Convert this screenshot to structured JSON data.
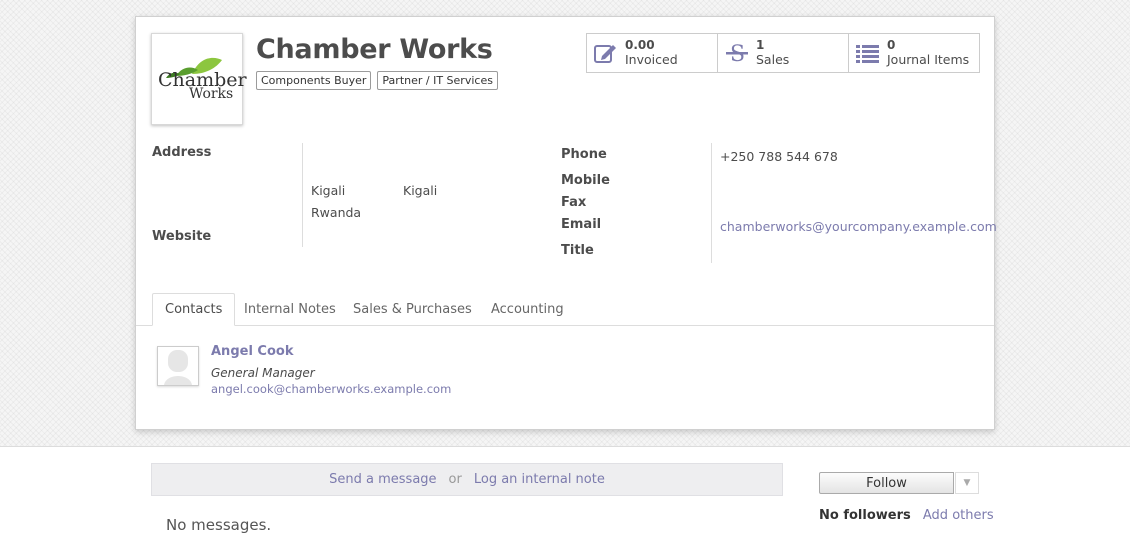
{
  "partner": {
    "name": "Chamber Works",
    "logo_text_line1": "Chamber",
    "logo_text_line2": "Works",
    "tags": [
      "Components Buyer",
      "Partner / IT Services"
    ]
  },
  "smart_buttons": [
    {
      "value": "0.00",
      "label": "Invoiced",
      "icon": "pencil-square-icon"
    },
    {
      "value": "1",
      "label": "Sales",
      "icon": "strikethrough-s-icon"
    },
    {
      "value": "0",
      "label": "Journal Items",
      "icon": "list-icon"
    }
  ],
  "fields": {
    "address_label": "Address",
    "website_label": "Website",
    "city": "Kigali",
    "state": "Kigali",
    "country": "Rwanda",
    "phone_label": "Phone",
    "mobile_label": "Mobile",
    "fax_label": "Fax",
    "email_label": "Email",
    "title_label": "Title",
    "phone": "+250 788 544 678",
    "email": "chamberworks@yourcompany.example.com"
  },
  "tabs": [
    {
      "label": "Contacts",
      "active": true
    },
    {
      "label": "Internal Notes",
      "active": false
    },
    {
      "label": "Sales & Purchases",
      "active": false
    },
    {
      "label": "Accounting",
      "active": false
    }
  ],
  "contact": {
    "name": "Angel Cook",
    "function": "General Manager",
    "email": "angel.cook@chamberworks.example.com"
  },
  "chatter": {
    "send_message": "Send a message",
    "or": "or",
    "log_note": "Log an internal note",
    "no_messages": "No messages.",
    "follow": "Follow",
    "no_followers": "No followers",
    "add_others": "Add others"
  },
  "colors": {
    "link": "#7c7bad",
    "text": "#4c4c4c",
    "logo_green": "#8cc63f"
  }
}
